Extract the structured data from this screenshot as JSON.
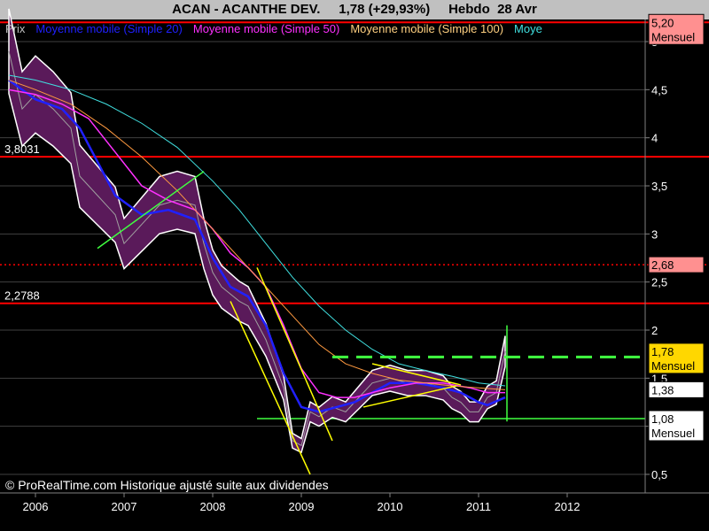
{
  "header": {
    "symbol": "ACAN",
    "name": "ACANTHE DEV.",
    "price_change": "1,78 (+29,93%)",
    "period": "Hebdo",
    "date": "28 Avr"
  },
  "legend": [
    {
      "label": "Prix",
      "color": "#c0c0c0"
    },
    {
      "label": "Moyenne mobile (Simple 20)",
      "color": "#2020ff"
    },
    {
      "label": "Moyenne mobile (Simple 50)",
      "color": "#ff30ff"
    },
    {
      "label": "Moyenne mobile (Simple 100)",
      "color": "#ffd080"
    },
    {
      "label": "Moye",
      "color": "#40e0e0"
    }
  ],
  "footer": "© ProRealTime.com Historique ajusté suite aux dividendes",
  "chart_data": {
    "type": "line",
    "x_range": [
      2005.7,
      2012.85
    ],
    "ylim": [
      0.4,
      5.3
    ],
    "x_ticks": [
      "2006",
      "2007",
      "2008",
      "2009",
      "2010",
      "2011",
      "2012"
    ],
    "y_ticks": [
      "0,5",
      "1",
      "1,5",
      "2",
      "2,5",
      "3",
      "3,5",
      "4",
      "4,5",
      "5"
    ],
    "price_labels": [
      {
        "text": "5,20",
        "sub": "Mensuel",
        "value": 5.2,
        "bg": "#ff9090"
      },
      {
        "text": "2,68",
        "value": 2.68,
        "bg": "#ff9090"
      },
      {
        "text": "1,78",
        "sub": "Mensuel",
        "value": 1.78,
        "bg": "#ffd700"
      },
      {
        "text": "1,38",
        "value": 1.38,
        "bg": "#ffffff"
      },
      {
        "text": "1,08",
        "sub": "Mensuel",
        "value": 1.08,
        "bg": "#ffffff"
      }
    ],
    "level_labels": [
      {
        "text": "3,8031",
        "value": 3.8031
      },
      {
        "text": "2,2788",
        "value": 2.2788
      }
    ],
    "series": [
      {
        "name": "Prix",
        "x": [
          2005.7,
          2005.85,
          2006.0,
          2006.2,
          2006.4,
          2006.5,
          2006.7,
          2006.9,
          2007.0,
          2007.2,
          2007.4,
          2007.6,
          2007.8,
          2007.9,
          2008.0,
          2008.1,
          2008.3,
          2008.4,
          2008.6,
          2008.8,
          2008.9,
          2009.0,
          2009.1,
          2009.2,
          2009.35,
          2009.5,
          2009.6,
          2009.8,
          2010.0,
          2010.2,
          2010.4,
          2010.6,
          2010.7,
          2010.8,
          2010.9,
          2011.0,
          2011.1,
          2011.2,
          2011.3
        ],
        "values": [
          4.9,
          4.3,
          4.45,
          4.3,
          4.1,
          3.6,
          3.4,
          3.2,
          2.9,
          3.1,
          3.3,
          3.35,
          3.3,
          2.9,
          2.6,
          2.45,
          2.3,
          2.25,
          1.9,
          1.4,
          0.85,
          0.8,
          1.15,
          1.1,
          1.2,
          1.15,
          1.25,
          1.45,
          1.5,
          1.45,
          1.45,
          1.4,
          1.3,
          1.25,
          1.15,
          1.15,
          1.3,
          1.35,
          1.78
        ]
      },
      {
        "name": "Moyenne mobile (Simple 20)",
        "x": [
          2005.7,
          2006.0,
          2006.3,
          2006.5,
          2006.7,
          2006.9,
          2007.2,
          2007.5,
          2007.8,
          2008.0,
          2008.2,
          2008.4,
          2008.6,
          2008.8,
          2009.0,
          2009.2,
          2009.4,
          2009.6,
          2009.8,
          2010.0,
          2010.3,
          2010.6,
          2010.8,
          2011.0,
          2011.1,
          2011.3
        ],
        "values": [
          4.6,
          4.4,
          4.3,
          4.1,
          3.75,
          3.4,
          3.2,
          3.25,
          3.15,
          2.75,
          2.45,
          2.35,
          2.05,
          1.55,
          1.2,
          1.15,
          1.2,
          1.25,
          1.35,
          1.45,
          1.45,
          1.4,
          1.35,
          1.25,
          1.22,
          1.3
        ]
      },
      {
        "name": "Moyenne mobile (Simple 50)",
        "x": [
          2005.7,
          2006.0,
          2006.3,
          2006.6,
          2006.9,
          2007.2,
          2007.5,
          2007.8,
          2008.0,
          2008.2,
          2008.4,
          2008.6,
          2008.8,
          2009.0,
          2009.2,
          2009.4,
          2009.6,
          2009.8,
          2010.0,
          2010.3,
          2010.6,
          2010.9,
          2011.1,
          2011.3
        ],
        "values": [
          4.5,
          4.45,
          4.35,
          4.2,
          3.85,
          3.5,
          3.35,
          3.25,
          3.05,
          2.8,
          2.65,
          2.45,
          2.05,
          1.6,
          1.35,
          1.3,
          1.3,
          1.35,
          1.4,
          1.45,
          1.45,
          1.4,
          1.35,
          1.35
        ]
      },
      {
        "name": "Moyenne mobile (Simple 100)",
        "x": [
          2005.7,
          2006.0,
          2006.4,
          2006.8,
          2007.2,
          2007.6,
          2008.0,
          2008.3,
          2008.6,
          2008.9,
          2009.2,
          2009.5,
          2009.8,
          2010.1,
          2010.4,
          2010.7,
          2011.0,
          2011.3
        ],
        "values": [
          4.6,
          4.5,
          4.35,
          4.1,
          3.8,
          3.45,
          3.05,
          2.75,
          2.45,
          2.15,
          1.85,
          1.65,
          1.55,
          1.48,
          1.45,
          1.42,
          1.4,
          1.38
        ]
      },
      {
        "name": "Moye",
        "x": [
          2005.7,
          2006.0,
          2006.4,
          2006.8,
          2007.2,
          2007.6,
          2008.0,
          2008.3,
          2008.6,
          2008.9,
          2009.2,
          2009.5,
          2009.8,
          2010.1,
          2010.4,
          2010.7,
          2011.0,
          2011.3
        ],
        "values": [
          4.65,
          4.6,
          4.5,
          4.35,
          4.15,
          3.9,
          3.55,
          3.25,
          2.9,
          2.55,
          2.25,
          2.0,
          1.8,
          1.65,
          1.58,
          1.52,
          1.45,
          1.42
        ]
      }
    ],
    "horizontal_levels": [
      {
        "value": 5.2,
        "color": "#ff0000",
        "style": "solid"
      },
      {
        "value": 3.8031,
        "color": "#ff0000",
        "style": "solid"
      },
      {
        "value": 2.68,
        "color": "#ff0000",
        "style": "dotted"
      },
      {
        "value": 2.2788,
        "color": "#ff0000",
        "style": "solid"
      },
      {
        "value": 1.08,
        "color": "#40ff40",
        "style": "solid"
      }
    ],
    "trendlines": [
      {
        "x": [
          2006.7,
          2007.9
        ],
        "y": [
          2.85,
          3.65
        ],
        "color": "#40ff40"
      },
      {
        "x": [
          2008.2,
          2009.1
        ],
        "y": [
          2.3,
          0.5
        ],
        "color": "#ffff00"
      },
      {
        "x": [
          2008.5,
          2009.35
        ],
        "y": [
          2.65,
          0.85
        ],
        "color": "#ffff00"
      },
      {
        "x": [
          2009.35,
          2010.75
        ],
        "y": [
          1.72,
          1.72
        ],
        "color": "#40ff40",
        "dashed": true
      },
      {
        "x": [
          2010.75,
          2012.85
        ],
        "y": [
          1.72,
          1.72
        ],
        "color": "#40ff40",
        "dashed": true
      },
      {
        "x": [
          2009.7,
          2010.75
        ],
        "y": [
          1.2,
          1.42
        ],
        "color": "#ffff00"
      },
      {
        "x": [
          2009.8,
          2010.8
        ],
        "y": [
          1.65,
          1.43
        ],
        "color": "#ffff00"
      }
    ]
  }
}
